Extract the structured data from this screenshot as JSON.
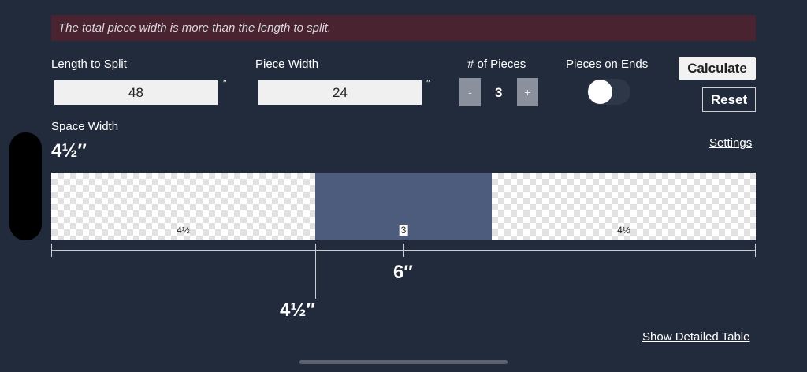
{
  "error": {
    "message": "The total piece width is more than the length to split."
  },
  "inputs": {
    "length_label": "Length to Split",
    "length_value": "48",
    "length_unit": "″",
    "piece_label": "Piece Width",
    "piece_value": "24",
    "piece_unit": "″",
    "count_label": "# of Pieces",
    "count_value": "3",
    "minus": "-",
    "plus": "+",
    "ends_label": "Pieces on Ends",
    "ends_on": false
  },
  "actions": {
    "calculate": "Calculate",
    "reset": "Reset",
    "settings": "Settings",
    "detail": "Show Detailed Table"
  },
  "space": {
    "label": "Space Width",
    "value": "4½″"
  },
  "diagram": {
    "segments": [
      {
        "type": "space",
        "label": "4½"
      },
      {
        "type": "piece",
        "label": "3"
      },
      {
        "type": "space",
        "label": "4½"
      }
    ],
    "dim_center": "6″",
    "dim_offset": "4½″"
  },
  "colors": {
    "background": "#222b3b",
    "error_bg": "#4a2330",
    "piece": "#4d5b7d"
  },
  "icons": {
    "toggle": "toggle-switch-icon"
  }
}
